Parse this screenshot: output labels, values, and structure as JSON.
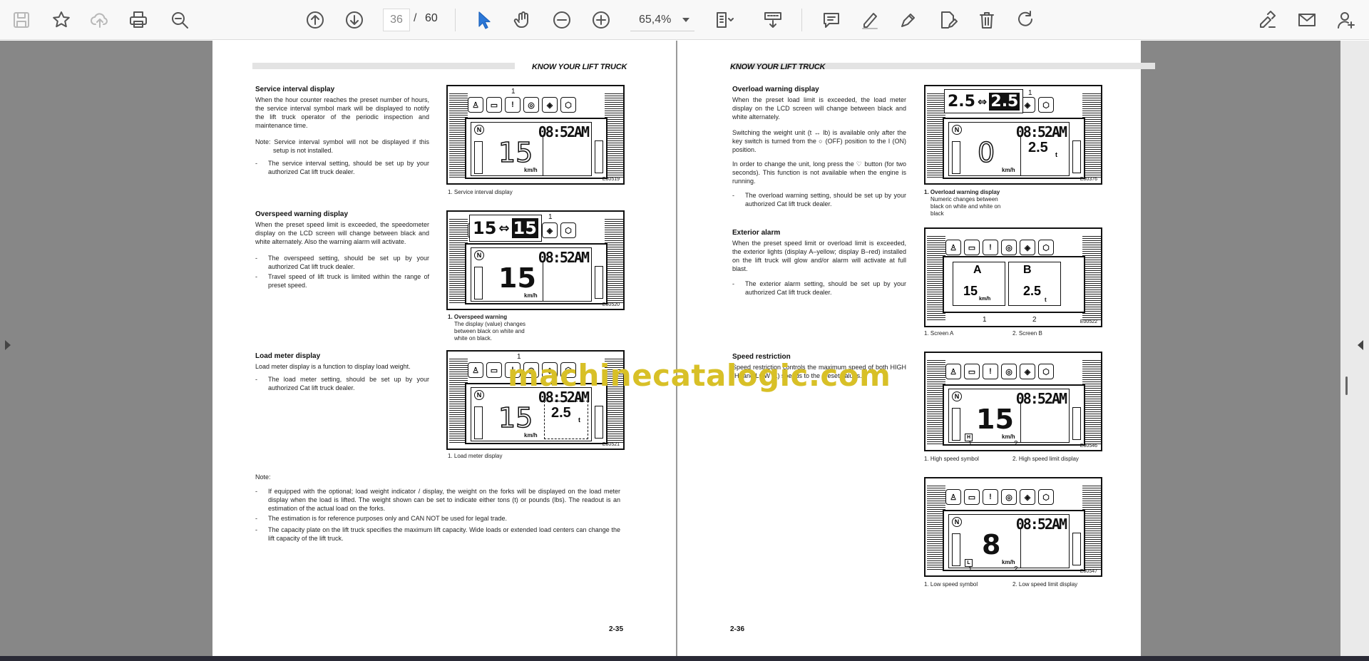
{
  "toolbar": {
    "current_page": "36",
    "page_separator": "/",
    "total_pages": "60",
    "zoom": "65,4%"
  },
  "left_page": {
    "header": "KNOW YOUR LIFT TRUCK",
    "page_number": "2-35",
    "service": {
      "title": "Service interval display",
      "body": "When the hour counter reaches the preset number of hours, the service interval symbol mark will be displayed to notify the lift truck operator of the periodic inspection and maintenance time.",
      "note": "Note: Service interval symbol will not be displayed if this setup is not installed.",
      "bullet": "The service interval setting, should be set up by your authorized Cat lift truck dealer.",
      "caption": "1. Service interval display",
      "fig": {
        "callout": "1",
        "time": "08:52AM",
        "speed": "15",
        "unit": "km/h",
        "code": "E00519"
      }
    },
    "overspeed": {
      "title": "Overspeed warning display",
      "body": "When the preset speed limit is exceeded, the speedometer display on the LCD screen will change between black and white alternately. Also the warning alarm will activate.",
      "bullet1": "The overspeed setting, should be set up by your authorized Cat lift truck dealer.",
      "bullet2": "Travel speed of lift truck is limited within the range of preset speed.",
      "caption_title": "1. Overspeed warning",
      "caption_body": "The display (value) changes between black on white and white on black.",
      "fig": {
        "callout": "1",
        "time": "08:52AM",
        "speed": "15",
        "unit": "km/h",
        "popup_a": "15",
        "popup_arrow": "⇔",
        "popup_b": "15",
        "code": "E00520"
      }
    },
    "loadmeter": {
      "title": "Load meter display",
      "body": "Load meter display is a function to display load weight.",
      "bullet": "The load meter setting, should be set up by your authorized Cat lift truck dealer.",
      "caption": "1. Load meter display",
      "fig": {
        "callout": "1",
        "time": "08:52AM",
        "speed": "15",
        "unit": "km/h",
        "load": "2.5",
        "load_unit": "t",
        "code": "E00521"
      }
    },
    "note": {
      "title": "Note:",
      "b1": "If equipped with the optional; load weight indicator / display, the weight on the forks will be displayed on the load meter display when the load is lifted. The weight shown can be set to indicate either tons (t) or pounds (lbs). The readout is an estimation of the actual load on the forks.",
      "b2": "The estimation is for reference purposes only and CAN NOT be used for legal trade.",
      "b3": "The capacity plate on the lift truck specifies the maximum lift capacity. Wide loads or extended load centers can change the lift capacity of the lift truck."
    }
  },
  "right_page": {
    "header": "KNOW YOUR LIFT TRUCK",
    "page_number": "2-36",
    "overload": {
      "title": "Overload warning display",
      "body1": "When the preset load limit is exceeded, the load meter display on the LCD screen will change between black and white alternately.",
      "body2": "Switching the weight unit (t ↔ lb) is available only after the key switch is turned from the ○ (OFF) position to the I (ON) position.",
      "body3": "In order to change the unit, long press the ♡ button (for two seconds). This function is not available when the engine is running.",
      "bullet": "The overload warning setting, should be set up by your authorized Cat lift truck dealer.",
      "caption_title": "1. Overload warning display",
      "caption_body": "Numeric changes between black on white and white on black",
      "fig": {
        "callout": "1",
        "time": "08:52AM",
        "speed": "0",
        "unit": "km/h",
        "load": "2.5",
        "load_unit": "t",
        "popup_a": "2.5",
        "popup_arrow": "⇔",
        "popup_b": "2.5",
        "code": "E00376"
      }
    },
    "exterior": {
      "title": "Exterior alarm",
      "body": "When the preset speed limit or overload limit is exceeded, the exterior lights (display A–yellow; display B–red) installed on the lift truck will glow and/or alarm will activate at full blast.",
      "bullet": "The exterior alarm setting, should be set up by your authorized Cat lift truck dealer.",
      "cap1": "1. Screen A",
      "cap2": "2. Screen B",
      "fig": {
        "label_a": "A",
        "label_b": "B",
        "speed": "15",
        "unit": "km/h",
        "load": "2.5",
        "load_unit": "t",
        "callout1": "1",
        "callout2": "2",
        "code": "E00522"
      }
    },
    "speed": {
      "title": "Speed restriction",
      "body": "Speed restriction controls the maximum speed of both HIGH (H) and LOW (L) speeds to the preset values.",
      "high_cap1": "1. High speed symbol",
      "high_cap2": "2. High speed limit display",
      "low_cap1": "1. Low speed symbol",
      "low_cap2": "2. Low speed limit display",
      "fig_high": {
        "time": "08:52AM",
        "speed": "15",
        "unit": "km/h",
        "mode": "H",
        "callout1": "1",
        "callout2": "2",
        "code": "E00546"
      },
      "fig_low": {
        "time": "08:52AM",
        "speed": "8",
        "unit": "km/h",
        "mode": "L",
        "callout1": "1",
        "callout2": "2",
        "code": "E00547"
      }
    }
  },
  "watermark": "machinecatalogic.com"
}
